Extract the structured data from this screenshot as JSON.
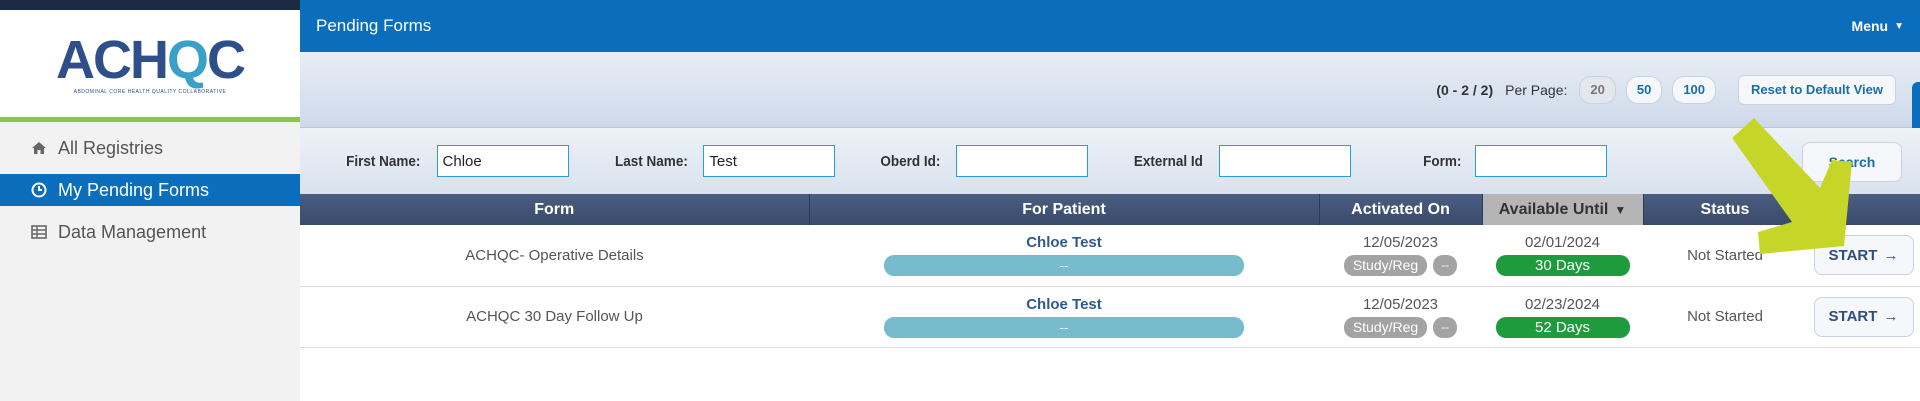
{
  "sidebar": {
    "logo": {
      "text": "ACHQC",
      "subtext": "ABDOMINAL CORE HEALTH QUALITY COLLABORATIVE"
    },
    "items": [
      {
        "label": "All Registries",
        "icon": "home-icon",
        "active": false
      },
      {
        "label": "My Pending Forms",
        "icon": "clock-icon",
        "active": true
      },
      {
        "label": "Data Management",
        "icon": "table-icon",
        "active": false
      }
    ]
  },
  "header": {
    "title": "Pending Forms",
    "menu_label": "Menu"
  },
  "pager": {
    "range": "(0 - 2 / 2)",
    "per_page_label": "Per Page:",
    "options": [
      "20",
      "50",
      "100"
    ],
    "selected": "20",
    "reset_label": "Reset to Default View"
  },
  "filters": {
    "first_name": {
      "label": "First Name:",
      "value": "Chloe"
    },
    "last_name": {
      "label": "Last Name:",
      "value": "Test"
    },
    "oberd_id": {
      "label": "Oberd Id:",
      "value": ""
    },
    "external_id": {
      "label": "External Id",
      "value": ""
    },
    "form": {
      "label": "Form:",
      "value": ""
    },
    "search_label": "Search"
  },
  "table": {
    "columns": [
      "Form",
      "For Patient",
      "Activated On",
      "Available Until",
      "Status",
      ""
    ],
    "sorted_column": "Available Until",
    "rows": [
      {
        "form": "ACHQC- Operative Details",
        "patient_name": "Chloe Test",
        "patient_sub": "--",
        "activated_on": "12/05/2023",
        "study_tag": "Study/Reg",
        "extra_tag": "--",
        "available_until": "02/01/2024",
        "days_left": "30 Days",
        "status": "Not Started",
        "action": "START"
      },
      {
        "form": "ACHQC 30 Day Follow Up",
        "patient_name": "Chloe Test",
        "patient_sub": "--",
        "activated_on": "12/05/2023",
        "study_tag": "Study/Reg",
        "extra_tag": "--",
        "available_until": "02/23/2024",
        "days_left": "52 Days",
        "status": "Not Started",
        "action": "START"
      }
    ]
  },
  "colors": {
    "primary_blue": "#0a6ebd",
    "sidebar_accent": "#8cc63f",
    "table_header": "#3f5173",
    "days_green": "#1e9b3c",
    "patient_bar": "#77bccd",
    "pointer_arrow": "#c5d628"
  }
}
